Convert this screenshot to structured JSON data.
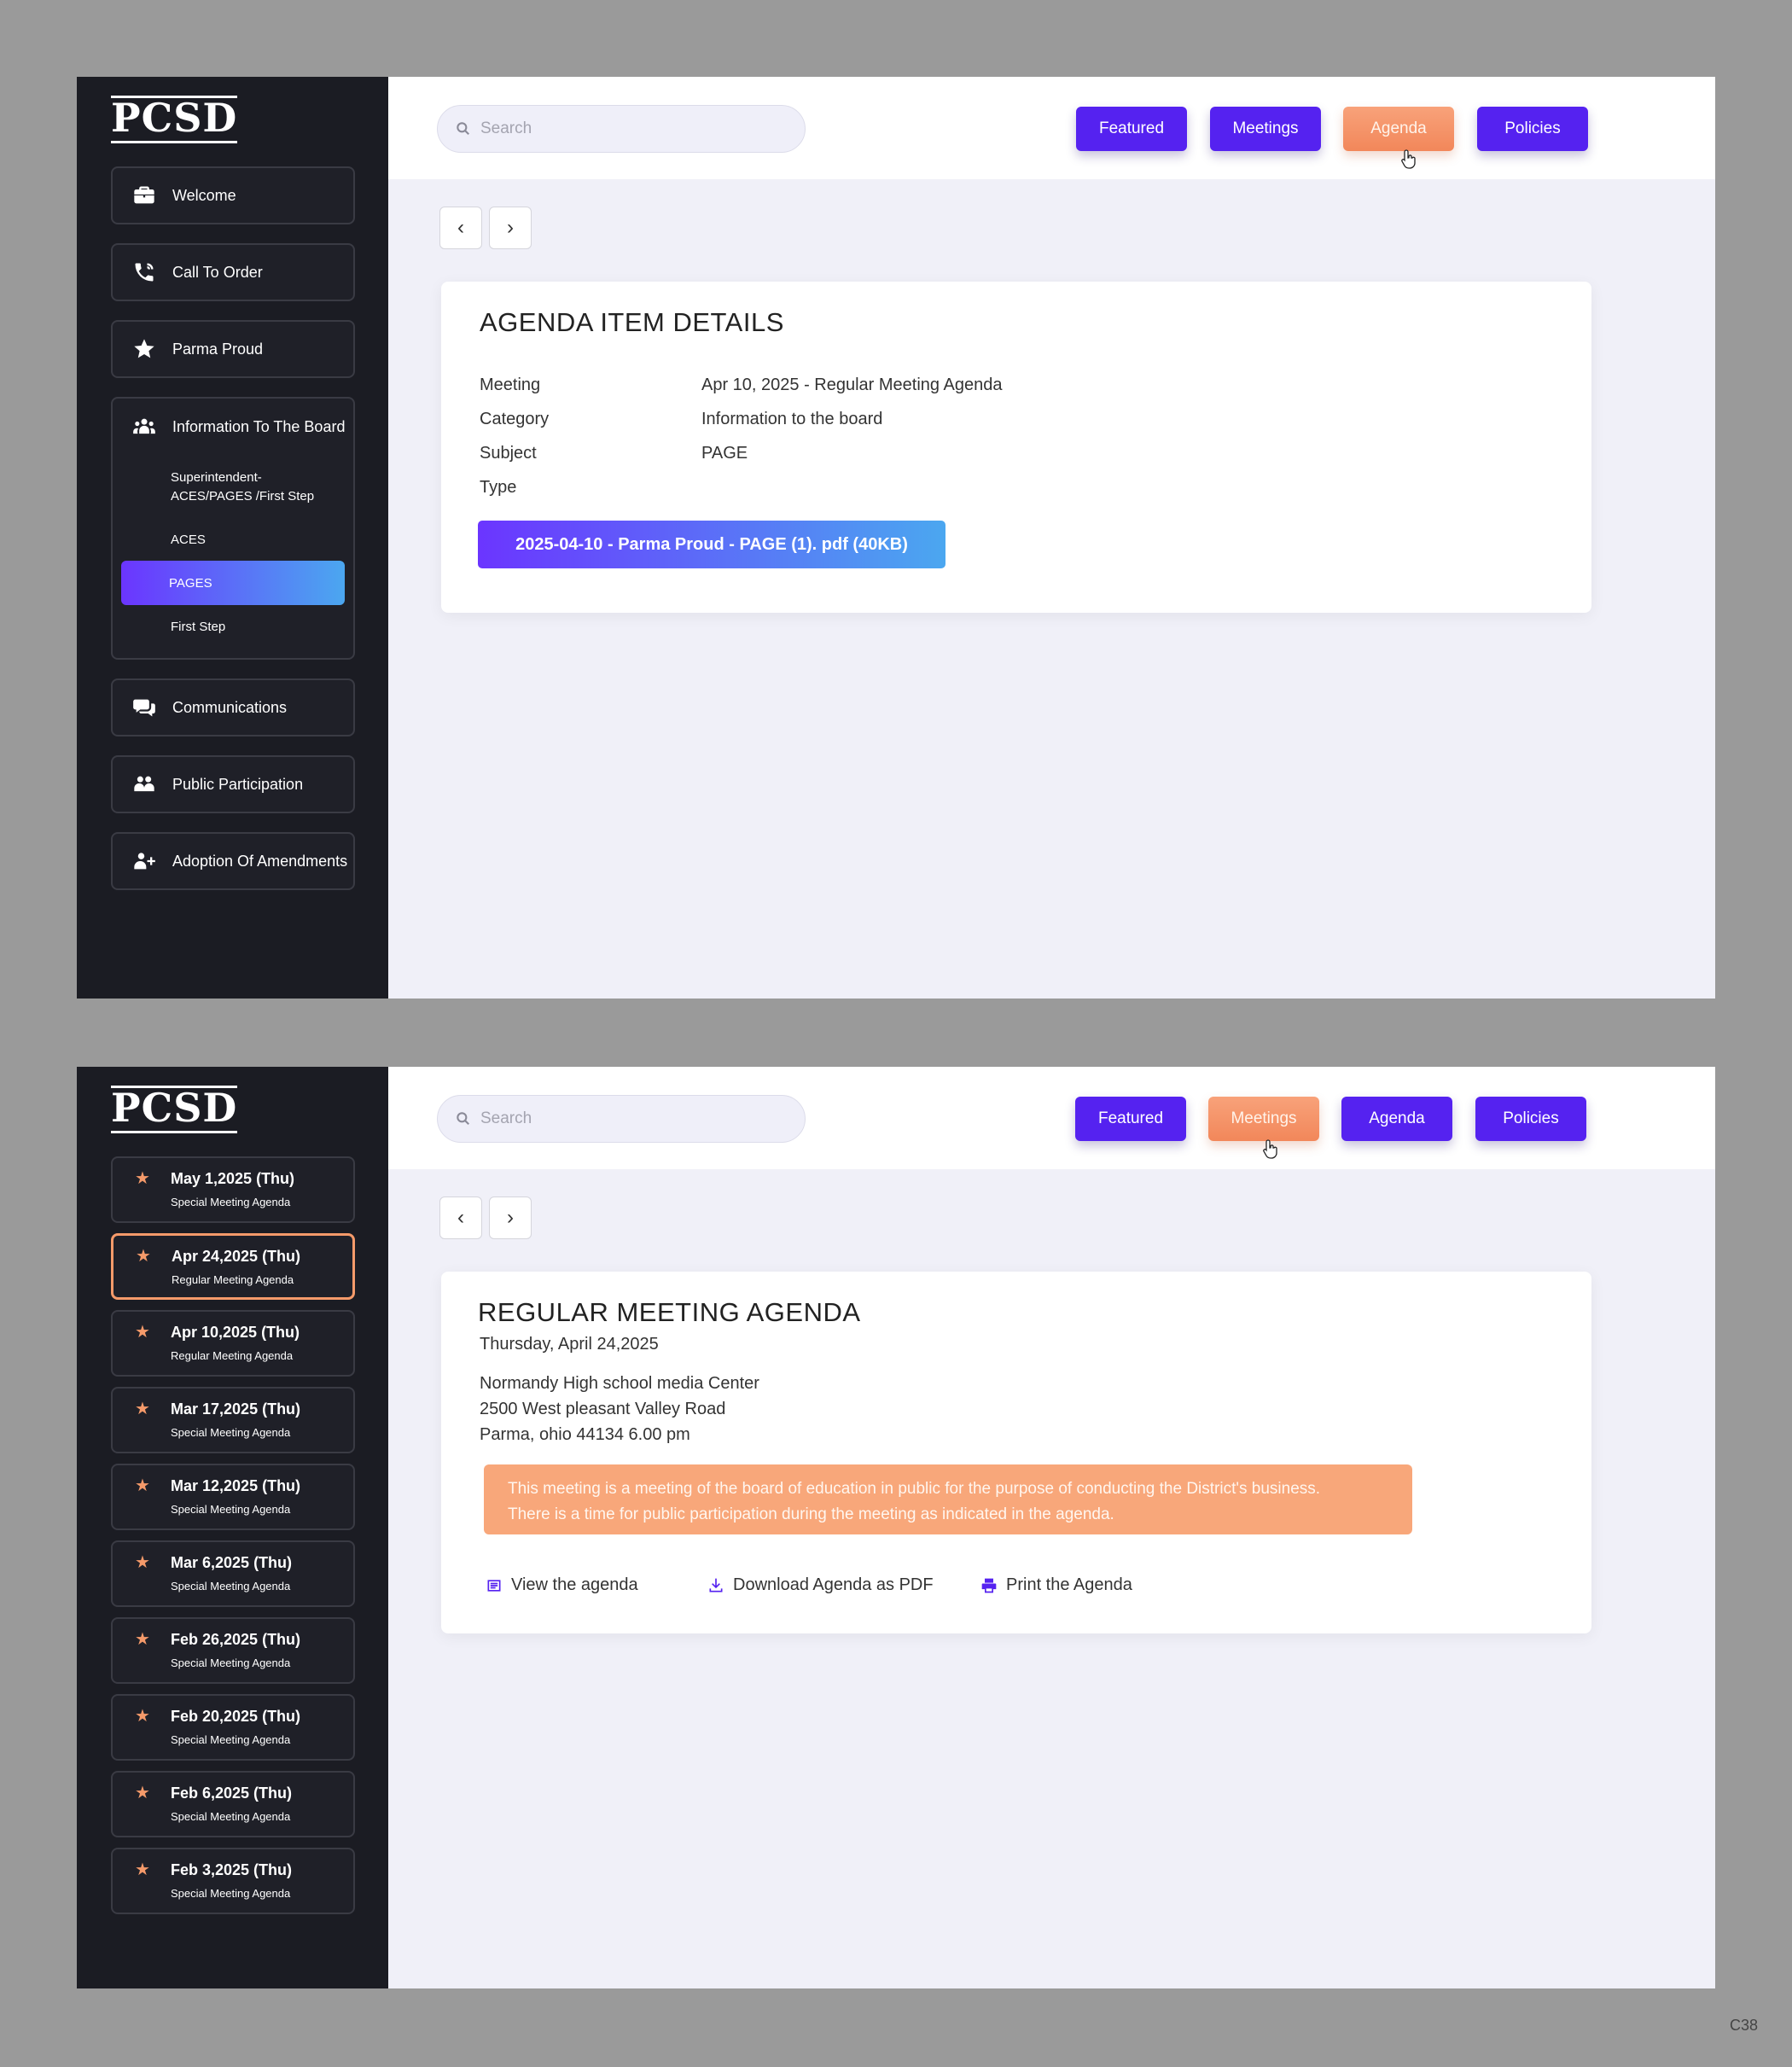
{
  "logo": "PCSD",
  "screen1": {
    "search_placeholder": "Search",
    "tabs": [
      "Featured",
      "Meetings",
      "Agenda",
      "Policies"
    ],
    "nav": [
      {
        "label": "Welcome",
        "icon": "briefcase-icon"
      },
      {
        "label": "Call To Order",
        "icon": "phone-icon"
      },
      {
        "label": "Parma Proud",
        "icon": "star-icon"
      }
    ],
    "group": {
      "label": "Information To The Board",
      "icon": "users-icon",
      "items": [
        "Superintendent-ACES/PAGES /First Step",
        "ACES",
        "PAGES",
        "First Step"
      ]
    },
    "nav_after": [
      {
        "label": "Communications",
        "icon": "chat-icon"
      },
      {
        "label": "Public Participation",
        "icon": "group-icon"
      },
      {
        "label": "Adoption Of Amendments",
        "icon": "user-plus-icon"
      }
    ],
    "card": {
      "title": "AGENDA ITEM DETAILS",
      "rows": [
        {
          "k": "Meeting",
          "v": "Apr 10, 2025 - Regular Meeting Agenda"
        },
        {
          "k": "Category",
          "v": "Information to the board"
        },
        {
          "k": "Subject",
          "v": "PAGE"
        },
        {
          "k": "Type",
          "v": ""
        }
      ],
      "file": "2025-04-10 - Parma Proud - PAGE (1). pdf (40KB)"
    }
  },
  "screen2": {
    "search_placeholder": "Search",
    "tabs": [
      "Featured",
      "Meetings",
      "Agenda",
      "Policies"
    ],
    "dates": [
      {
        "date": "May 1,2025 (Thu)",
        "type": "Special Meeting Agenda"
      },
      {
        "date": "Apr 24,2025 (Thu)",
        "type": "Regular Meeting Agenda"
      },
      {
        "date": "Apr 10,2025 (Thu)",
        "type": "Regular Meeting Agenda"
      },
      {
        "date": "Mar 17,2025 (Thu)",
        "type": "Special Meeting Agenda"
      },
      {
        "date": "Mar 12,2025 (Thu)",
        "type": "Special Meeting Agenda"
      },
      {
        "date": "Mar 6,2025 (Thu)",
        "type": "Special Meeting Agenda"
      },
      {
        "date": "Feb 26,2025 (Thu)",
        "type": "Special Meeting Agenda"
      },
      {
        "date": "Feb 20,2025 (Thu)",
        "type": "Special Meeting Agenda"
      },
      {
        "date": "Feb 6,2025 (Thu)",
        "type": "Special Meeting Agenda"
      },
      {
        "date": "Feb 3,2025 (Thu)",
        "type": "Special Meeting Agenda"
      }
    ],
    "card": {
      "title": "REGULAR MEETING AGENDA",
      "date": "Thursday, April 24,2025",
      "address": [
        "Normandy High school media Center",
        "2500 West pleasant Valley Road",
        "Parma, ohio 44134 6.00 pm"
      ],
      "notice": [
        "This meeting is a meeting of the board of education in public for the purpose of conducting the District's business.",
        "There is a time for public participation during the meeting as indicated in the agenda."
      ],
      "actions": [
        "View the agenda",
        "Download Agenda as PDF",
        "Print the Agenda"
      ]
    }
  },
  "corner_label": "C38",
  "colors": {
    "primary": "#5522f0",
    "accent": "#f59a6a",
    "sidebar": "#1b1c23"
  }
}
